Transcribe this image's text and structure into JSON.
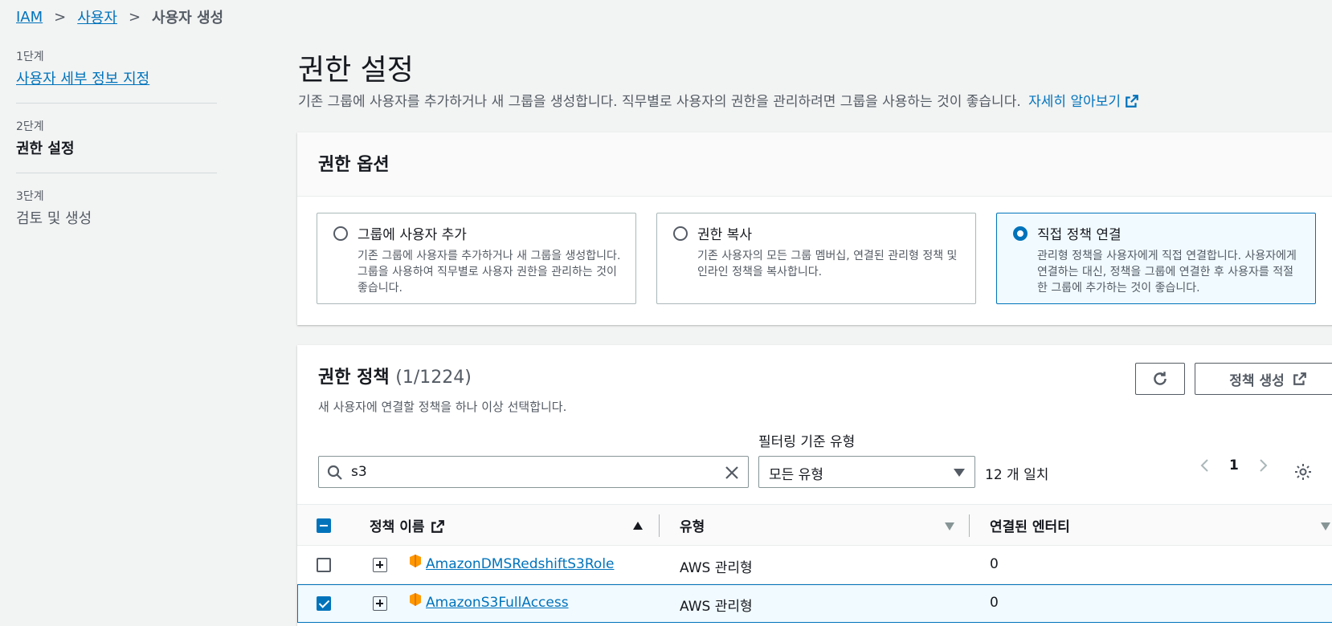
{
  "breadcrumb": {
    "root": "IAM",
    "parent": "사용자",
    "current": "사용자 생성"
  },
  "steps": [
    {
      "num": "1단계",
      "label": "사용자 세부 정보 지정"
    },
    {
      "num": "2단계",
      "label": "권한 설정"
    },
    {
      "num": "3단계",
      "label": "검토 및 생성"
    }
  ],
  "page": {
    "title": "권한 설정",
    "description": "기존 그룹에 사용자를 추가하거나 새 그룹을 생성합니다. 직무별로 사용자의 권한을 관리하려면 그룹을 사용하는 것이 좋습니다.",
    "learn_more": "자세히 알아보기"
  },
  "permission_options": {
    "heading": "권한 옵션",
    "options": [
      {
        "title": "그룹에 사용자 추가",
        "desc": "기존 그룹에 사용자를 추가하거나 새 그룹을 생성합니다. 그룹을 사용하여 직무별로 사용자 권한을 관리하는 것이 좋습니다.",
        "selected": false
      },
      {
        "title": "권한 복사",
        "desc": "기존 사용자의 모든 그룹 멤버십, 연결된 관리형 정책 및 인라인 정책을 복사합니다.",
        "selected": false
      },
      {
        "title": "직접 정책 연결",
        "desc": "관리형 정책을 사용자에게 직접 연결합니다. 사용자에게 연결하는 대신, 정책을 그룹에 연결한 후 사용자를 적절한 그룹에 추가하는 것이 좋습니다.",
        "selected": true
      }
    ]
  },
  "policies": {
    "heading": "권한 정책",
    "count": "(1/1224)",
    "description": "새 사용자에 연결할 정책을 하나 이상 선택합니다.",
    "create_button": "정책 생성",
    "filter_label": "필터링 기준 유형",
    "search_value": "s3",
    "filter_value": "모든 유형",
    "match_count": "12 개 일치",
    "page": "1",
    "columns": {
      "name": "정책 이름",
      "type": "유형",
      "entities": "연결된 엔터티"
    },
    "rows": [
      {
        "name": "AmazonDMSRedshiftS3Role",
        "type": "AWS 관리형",
        "entities": "0",
        "checked": false
      },
      {
        "name": "AmazonS3FullAccess",
        "type": "AWS 관리형",
        "entities": "0",
        "checked": true
      }
    ]
  }
}
